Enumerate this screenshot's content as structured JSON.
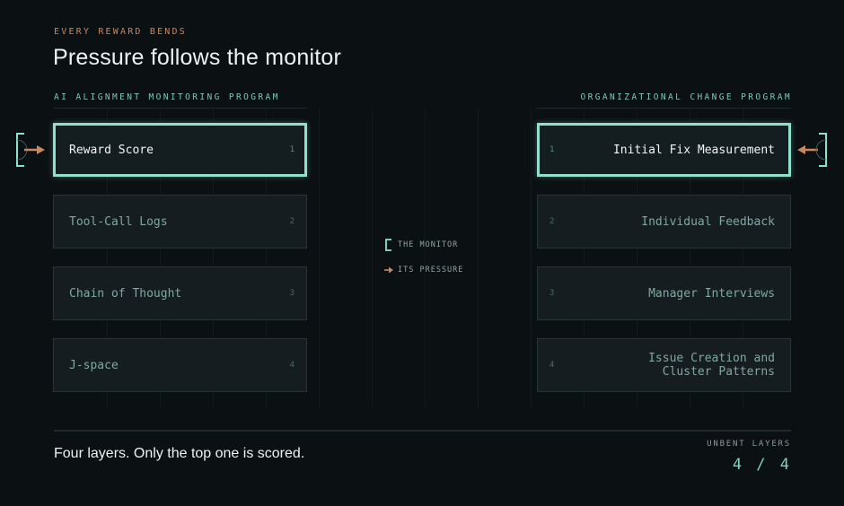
{
  "header": {
    "eyebrow": "EVERY REWARD BENDS",
    "title": "Pressure follows the monitor"
  },
  "left_program": {
    "title": "AI ALIGNMENT MONITORING PROGRAM",
    "layers": [
      {
        "label": "Reward Score",
        "number": "1",
        "monitored": true
      },
      {
        "label": "Tool-Call Logs",
        "number": "2",
        "monitored": false
      },
      {
        "label": "Chain of Thought",
        "number": "3",
        "monitored": false
      },
      {
        "label": "J-space",
        "number": "4",
        "monitored": false
      }
    ]
  },
  "right_program": {
    "title": "ORGANIZATIONAL CHANGE PROGRAM",
    "layers": [
      {
        "label": "Initial Fix Measurement",
        "number": "1",
        "monitored": true
      },
      {
        "label": "Individual Feedback",
        "number": "2",
        "monitored": false
      },
      {
        "label": "Manager Interviews",
        "number": "3",
        "monitored": false
      },
      {
        "label": "Issue Creation and Cluster Patterns",
        "number": "4",
        "monitored": false
      }
    ]
  },
  "legend": {
    "monitor_label": "THE MONITOR",
    "pressure_label": "ITS PRESSURE"
  },
  "footer": {
    "summary": "Four layers. Only the top one is scored.",
    "count_label": "UNBENT LAYERS",
    "count_value": "4 / 4"
  },
  "colors": {
    "background": "#0b1013",
    "monitor_accent": "#8fe0cd",
    "pressure_accent": "#c9875d",
    "box_fill": "#151d21"
  },
  "icons": {
    "monitor": "bracket-icon",
    "pressure": "arrow-icon"
  }
}
